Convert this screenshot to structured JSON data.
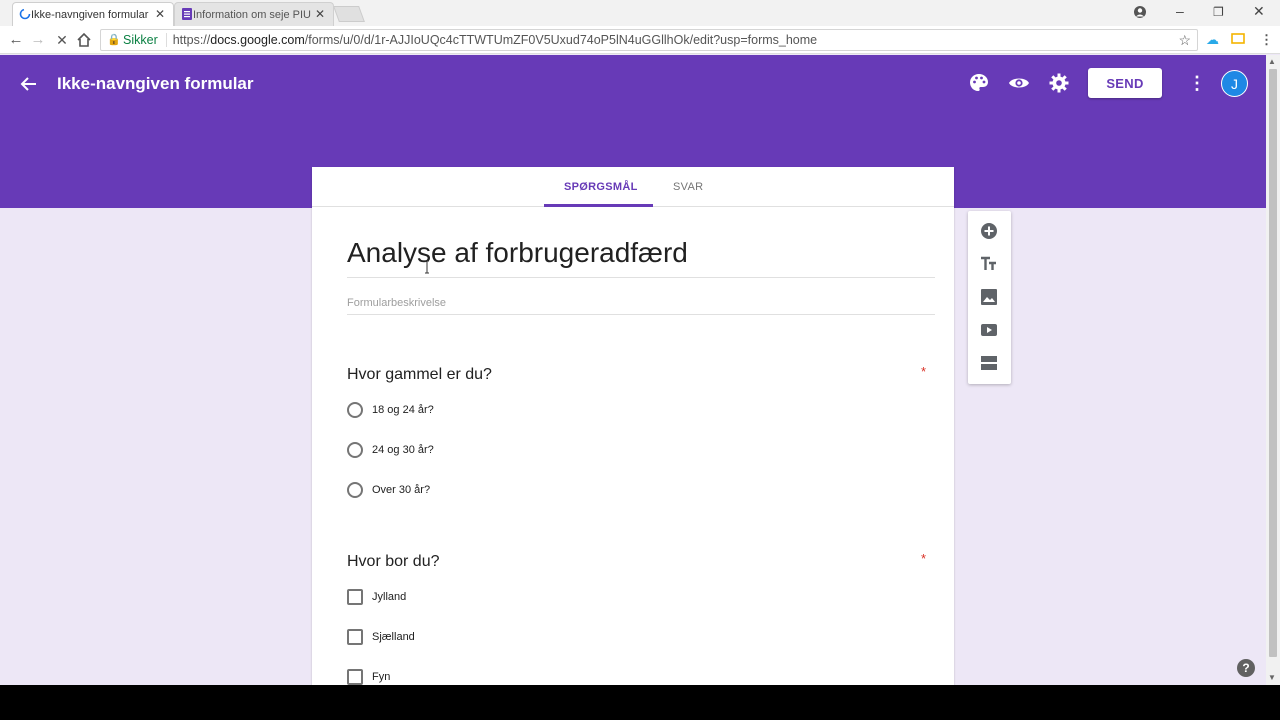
{
  "browser": {
    "tabs": [
      {
        "label": "Ikke-navngiven formular",
        "active": true
      },
      {
        "label": "Information om seje PIU",
        "active": false
      }
    ],
    "security_label": "Sikker",
    "url_prefix": "https://",
    "url_host": "docs.google.com",
    "url_path": "/forms/u/0/d/1r-AJJIoUQc4cTTWTUmZF0V5Uxud74oP5lN4uGGllhOk/edit?usp=forms_home"
  },
  "header": {
    "title": "Ikke-navngiven formular",
    "send_label": "SEND",
    "avatar_initial": "J",
    "color": "#673ab7"
  },
  "tabs": {
    "questions": "SPØRGSMÅL",
    "answers": "SVAR"
  },
  "form": {
    "title": "Analyse af forbrugeradfærd",
    "description_placeholder": "Formularbeskrivelse"
  },
  "questions": [
    {
      "text": "Hvor gammel er du?",
      "required_mark": "*",
      "type": "radio",
      "options": [
        "18 og 24 år?",
        "24 og 30 år?",
        "Over 30 år?"
      ]
    },
    {
      "text": "Hvor bor du?",
      "required_mark": "*",
      "type": "checkbox",
      "options": [
        "Jylland",
        "Sjælland",
        "Fyn"
      ]
    }
  ],
  "help_label": "?"
}
